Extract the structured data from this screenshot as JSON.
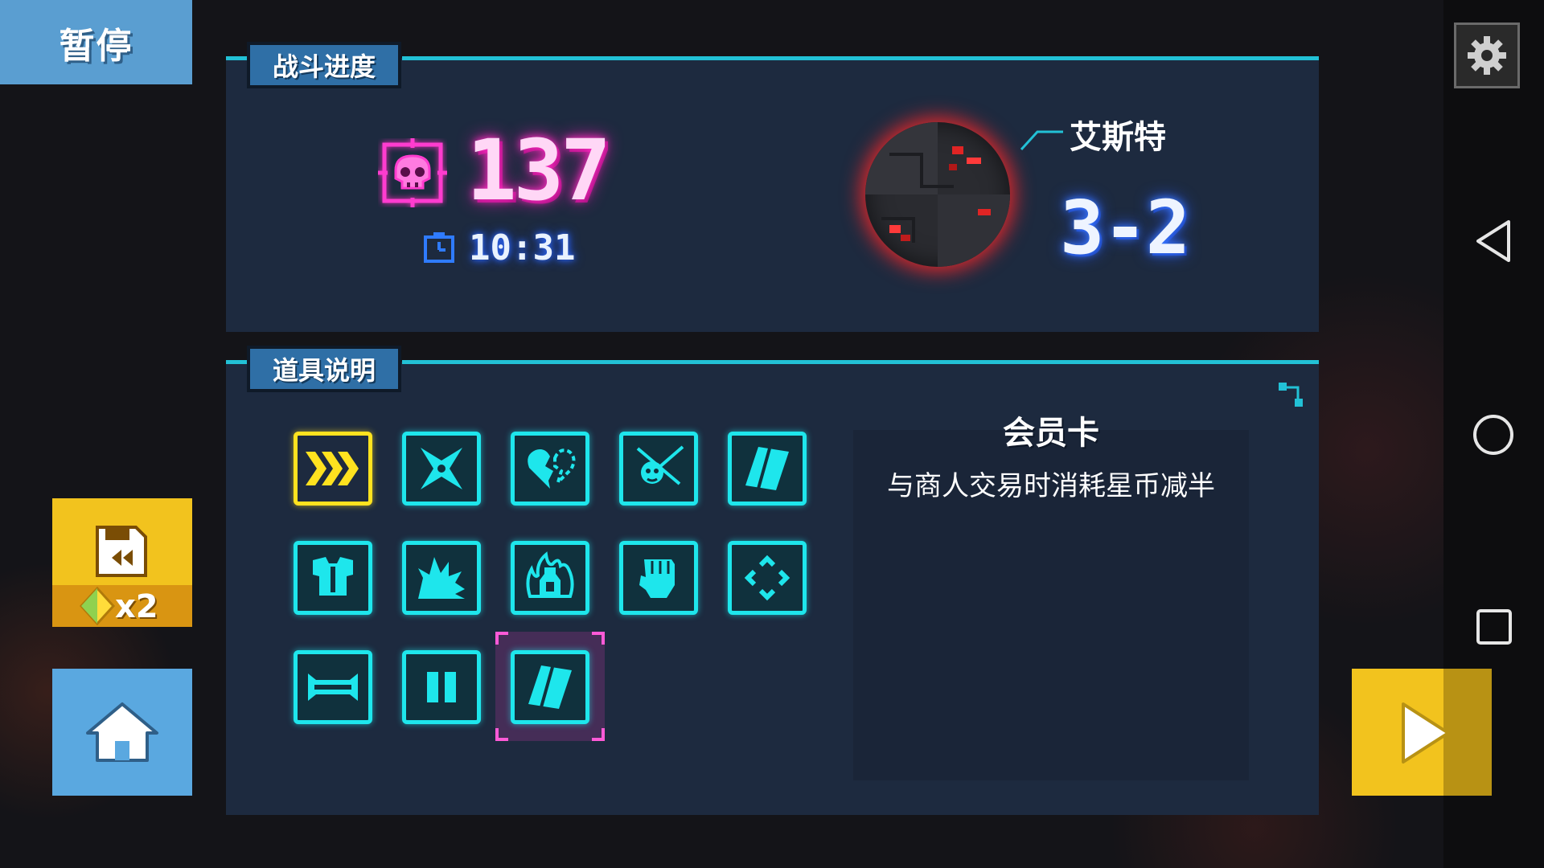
{
  "header": {
    "pause_label": "暂停"
  },
  "battle_progress": {
    "tab_label": "战斗进度",
    "kills": "137",
    "time": "10:31",
    "planet_name": "艾斯特",
    "level": "3-2"
  },
  "items": {
    "tab_label": "道具说明",
    "grid": [
      {
        "name": "speed-chevrons",
        "icon": "triple-chevron-icon",
        "highlight": "gold"
      },
      {
        "name": "shuriken",
        "icon": "shuriken-icon"
      },
      {
        "name": "broken-heart",
        "icon": "broken-heart-icon"
      },
      {
        "name": "skull-sword",
        "icon": "skull-sword-icon"
      },
      {
        "name": "member-card",
        "icon": "card-icon"
      },
      {
        "name": "armor",
        "icon": "armor-icon"
      },
      {
        "name": "explosion",
        "icon": "explosion-icon"
      },
      {
        "name": "burning-bottle",
        "icon": "burning-bottle-icon"
      },
      {
        "name": "fist",
        "icon": "fist-icon"
      },
      {
        "name": "target-diamond",
        "icon": "diamond-arrows-icon"
      },
      {
        "name": "bumper",
        "icon": "bumper-icon"
      },
      {
        "name": "pause-item",
        "icon": "pause-icon"
      },
      {
        "name": "member-card-selected",
        "icon": "card-icon",
        "selected": true
      }
    ],
    "selected": {
      "title": "会员卡",
      "description": "与商人交易时消耗星币减半"
    }
  },
  "buttons": {
    "rewind_count": "x2"
  },
  "colors": {
    "accent_cyan": "#1ee6ec",
    "kill_pink": "#ff2ec4",
    "pause_blue": "#5a9ed1",
    "button_gold": "#f2c31e",
    "panel_bg": "#1d2a3f"
  }
}
